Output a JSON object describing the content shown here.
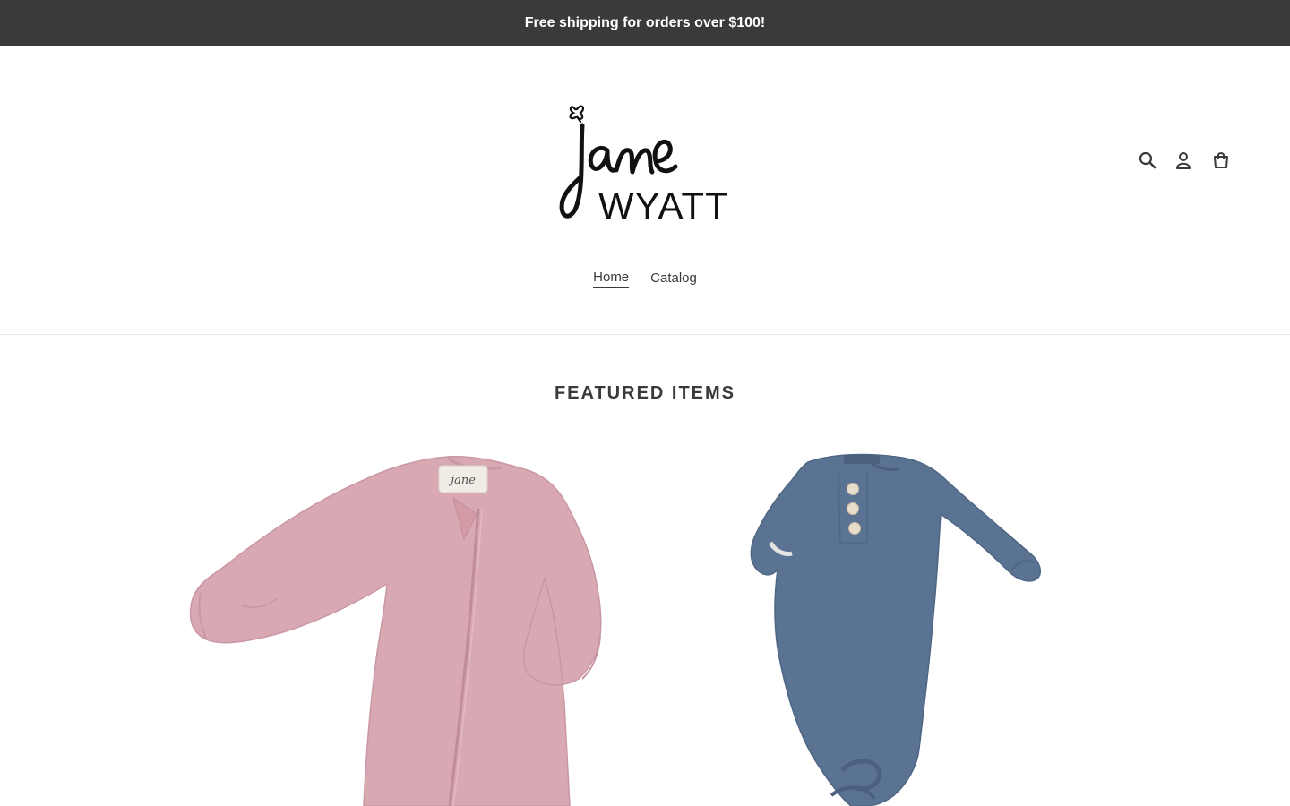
{
  "announcement": {
    "text": "Free shipping for orders over $100!"
  },
  "header": {
    "logo": {
      "name": "jane WYATT",
      "script": "jane",
      "wordmark": "WYATT"
    },
    "icons": [
      {
        "name": "search-icon",
        "label": "Search"
      },
      {
        "name": "account-icon",
        "label": "Log in"
      },
      {
        "name": "cart-icon",
        "label": "Cart"
      }
    ]
  },
  "nav": {
    "items": [
      {
        "label": "Home",
        "active": true
      },
      {
        "label": "Catalog",
        "active": false
      }
    ]
  },
  "featured": {
    "title": "FEATURED ITEMS",
    "products": [
      {
        "image": "pink ribbed zip romper",
        "color": "#d9a9b3"
      },
      {
        "image": "slate blue knotted gown",
        "color": "#5b7393"
      }
    ]
  },
  "colors": {
    "announcement_bg": "#3a3a3a",
    "announcement_text": "#ffffff",
    "text": "#3a3a3a",
    "divider": "#e8e8e1"
  }
}
